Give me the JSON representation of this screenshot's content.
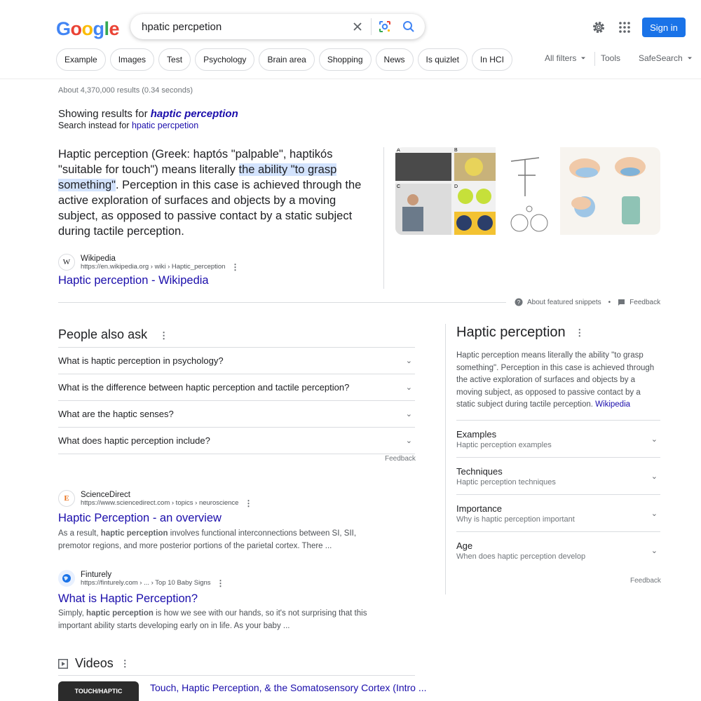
{
  "logo": {
    "letters": [
      "G",
      "o",
      "o",
      "g",
      "l",
      "e"
    ],
    "colors": [
      "#4285f4",
      "#ea4335",
      "#fbbc05",
      "#4285f4",
      "#34a853",
      "#ea4335"
    ]
  },
  "search": {
    "query": "hpatic percpetion"
  },
  "header": {
    "signin_label": "Sign in"
  },
  "chips": [
    "Example",
    "Images",
    "Test",
    "Psychology",
    "Brain area",
    "Shopping",
    "News",
    "Is quizlet",
    "In HCI"
  ],
  "filters": {
    "all_filters": "All filters",
    "tools": "Tools",
    "safesearch": "SafeSearch"
  },
  "stats": "About 4,370,000 results (0.34 seconds)",
  "spelling": {
    "showing_prefix": "Showing results for",
    "showing_term": "haptic perception",
    "instead_prefix": "Search instead for",
    "instead_term": "hpatic percpetion"
  },
  "featured": {
    "text_before": "Haptic perception (Greek: haptós \"palpable\", haptikós \"suitable for touch\") means literally ",
    "highlight": "the ability \"to grasp something\"",
    "text_after": ". Perception in this case is achieved through the active exploration of surfaces and objects by a moving subject, as opposed to passive contact by a static subject during tactile perception.",
    "source_name": "Wikipedia",
    "source_url": "https://en.wikipedia.org › wiki › Haptic_perception",
    "title": "Haptic perception - Wikipedia",
    "about_label": "About featured snippets",
    "feedback": "Feedback"
  },
  "paa": {
    "title": "People also ask",
    "questions": [
      "What is haptic perception in psychology?",
      "What is the difference between haptic perception and tactile perception?",
      "What are the haptic senses?",
      "What does haptic perception include?"
    ],
    "feedback": "Feedback"
  },
  "results": [
    {
      "source_name": "ScienceDirect",
      "source_url": "https://www.sciencedirect.com › topics › neuroscience",
      "title": "Haptic Perception - an overview",
      "snippet_pre": "As a result, ",
      "snippet_bold": "haptic perception",
      "snippet_post": " involves functional interconnections between SI, SII, premotor regions, and more posterior portions of the parietal cortex. There ...",
      "favicon": "E"
    },
    {
      "source_name": "Finturely",
      "source_url": "https://finturely.com › ... › Top 10 Baby Signs",
      "title": "What is Haptic Perception?",
      "snippet_pre": "Simply, ",
      "snippet_bold": "haptic perception",
      "snippet_post": " is how we see with our hands, so it's not surprising that this important ability starts developing early on in life. As your baby ..."
    }
  ],
  "knowledge_panel": {
    "title": "Haptic perception",
    "description": "Haptic perception means literally the ability \"to grasp something\". Perception in this case is achieved through the active exploration of surfaces and objects by a moving subject, as opposed to passive contact by a static subject during tactile perception.",
    "source_link": "Wikipedia",
    "items": [
      {
        "title": "Examples",
        "subtitle": "Haptic perception examples"
      },
      {
        "title": "Techniques",
        "subtitle": "Haptic perception techniques"
      },
      {
        "title": "Importance",
        "subtitle": "Why is haptic perception important"
      },
      {
        "title": "Age",
        "subtitle": "When does haptic perception develop"
      }
    ],
    "feedback": "Feedback"
  },
  "videos": {
    "title": "Videos",
    "first_title": "Touch, Haptic Perception, & the Somatosensory Cortex (Intro ...",
    "thumb_text": "TOUCH/HAPTIC"
  },
  "colors": {
    "link": "#1a0dab",
    "accent": "#1a73e8"
  }
}
